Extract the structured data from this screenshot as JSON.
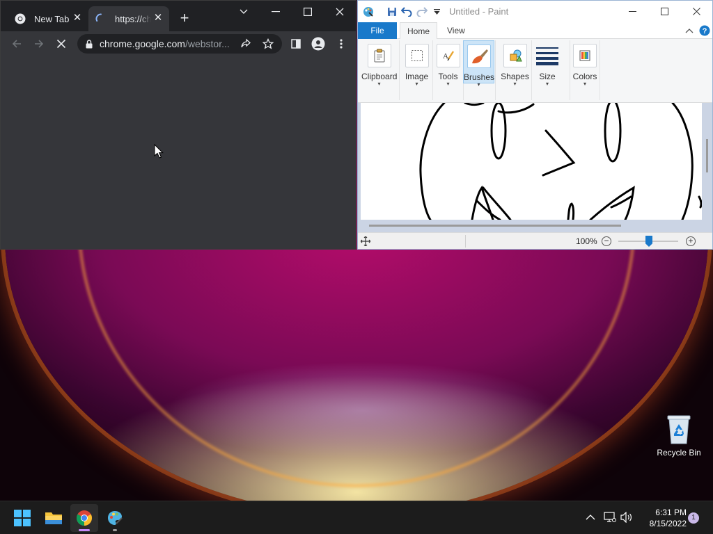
{
  "chrome": {
    "tabs": [
      {
        "title": "New Tab",
        "state": "inactive"
      },
      {
        "title": "https://ch",
        "state": "active-loading"
      }
    ],
    "address_bar": {
      "host": "chrome.google.com",
      "path": "/webstor...",
      "secure": true
    },
    "toolbar_icons": [
      "back-icon",
      "forward-icon",
      "stop-loading-icon",
      "lock-icon",
      "share-icon",
      "star-icon",
      "side-panel-icon",
      "profile-icon",
      "more-icon"
    ],
    "accent_colors": {
      "frame": "#202124",
      "toolbar": "#35363a",
      "text": "#e8eaed"
    }
  },
  "paint": {
    "title": "Untitled - Paint",
    "ribbon_tabs": [
      "File",
      "Home",
      "View"
    ],
    "active_ribbon_tab": "Home",
    "groups": [
      {
        "label": "Clipboard",
        "icon": "clipboard-icon"
      },
      {
        "label": "Image",
        "icon": "select-icon"
      },
      {
        "label": "Tools",
        "icon": "tools-icon"
      },
      {
        "label": "Brushes",
        "icon": "brush-icon",
        "selected": true
      },
      {
        "label": "Shapes",
        "icon": "shapes-icon"
      },
      {
        "label": "Size",
        "icon": "size-icon"
      },
      {
        "label": "Colors",
        "icon": "colors-icon"
      }
    ],
    "zoom": "100%",
    "accent_colors": {
      "file_tab": "#1979ca",
      "brushes_selected": "#cce4f7"
    }
  },
  "desktop": {
    "recycle_bin_label": "Recycle Bin"
  },
  "taskbar": {
    "apps": [
      "start-icon",
      "file-explorer-icon",
      "chrome-icon",
      "paint-icon"
    ],
    "active_app": "chrome-icon",
    "time": "6:31 PM",
    "date": "8/15/2022",
    "notification_count": "1"
  }
}
